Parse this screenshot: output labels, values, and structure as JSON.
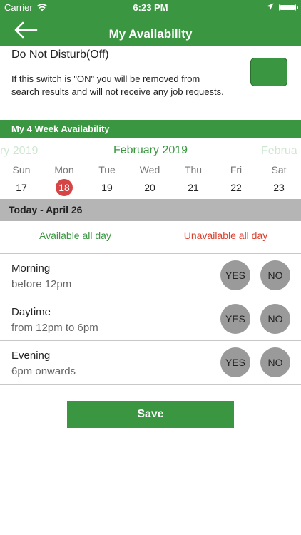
{
  "status_bar": {
    "carrier": "Carrier",
    "time": "6:23 PM"
  },
  "header": {
    "title": "My Availability"
  },
  "dnd": {
    "title": "Do Not Disturb(Off)",
    "description": "If this switch is \"ON\" you will be removed from search results and will not receive any job requests.",
    "toggle_color": "#3a9641"
  },
  "section": {
    "title": "My 4 Week Availability"
  },
  "calendar": {
    "prev_month": "ry 2019",
    "current_month": "February 2019",
    "next_month": "Februa",
    "days": [
      {
        "name": "Sun",
        "num": "17"
      },
      {
        "name": "Mon",
        "num": "18"
      },
      {
        "name": "Tue",
        "num": "19"
      },
      {
        "name": "Wed",
        "num": "20"
      },
      {
        "name": "Thu",
        "num": "21"
      },
      {
        "name": "Fri",
        "num": "22"
      },
      {
        "name": "Sat",
        "num": "23"
      }
    ],
    "selected_color": "#d64545"
  },
  "today": {
    "label": "Today - April 26"
  },
  "quick": {
    "available": "Available all day",
    "unavailable": "Unavailable all day"
  },
  "slots": [
    {
      "title": "Morning",
      "subtitle": "before 12pm",
      "yes": "YES",
      "no": "NO"
    },
    {
      "title": "Daytime",
      "subtitle": "from 12pm to 6pm",
      "yes": "YES",
      "no": "NO"
    },
    {
      "title": "Evening",
      "subtitle": "6pm onwards",
      "yes": "YES",
      "no": "NO"
    }
  ],
  "save": {
    "label": "Save"
  },
  "colors": {
    "brand": "#3a9641",
    "danger": "#d9412f",
    "button_gray": "#9a9a9a"
  }
}
